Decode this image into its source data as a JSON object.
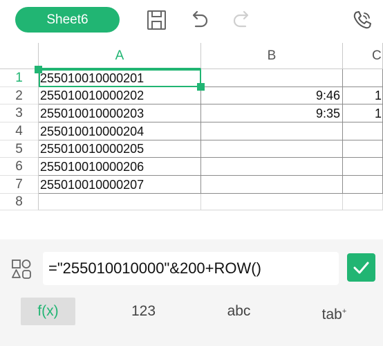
{
  "toolbar": {
    "sheet_name": "Sheet6",
    "icons": [
      "save-icon",
      "undo-icon",
      "redo-icon",
      "phone-icon"
    ]
  },
  "grid": {
    "columns": [
      "A",
      "B",
      "C"
    ],
    "rows": [
      "1",
      "2",
      "3",
      "4",
      "5",
      "6",
      "7",
      "8"
    ],
    "col_a": [
      "255010010000201",
      "255010010000202",
      "255010010000203",
      "255010010000204",
      "255010010000205",
      "255010010000206",
      "255010010000207"
    ],
    "col_b": [
      "",
      "9:46",
      "9:35",
      "",
      "",
      "",
      ""
    ],
    "col_c": [
      "",
      "1",
      "1",
      "",
      "",
      "",
      ""
    ],
    "selected_cell": "A1"
  },
  "formula_bar": {
    "formula": "=\"255010010000\"&200+ROW()"
  },
  "keyboard_tabs": [
    "f(x)",
    "123",
    "abc",
    "tab"
  ],
  "colors": {
    "accent": "#21b573",
    "grid_line": "#8c8c8c",
    "background": "#f5f5f5"
  }
}
